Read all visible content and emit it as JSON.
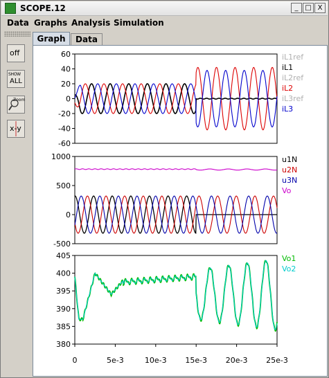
{
  "window": {
    "title": "SCOPE.12",
    "controls": {
      "minimize": "_",
      "maximize": "□",
      "close": "X"
    }
  },
  "menu": [
    "Data",
    "Graphs",
    "Analysis",
    "Simulation"
  ],
  "toolbar": {
    "off": "off",
    "show_all_top": "SHOW",
    "show_all_bottom": "ALL",
    "zoom": "Zoom",
    "xy": "x-y"
  },
  "tabs": [
    "Graph",
    "Data"
  ],
  "colors": {
    "iL1ref": "#b0b0b0",
    "iL1": "#000000",
    "iL2ref": "#b0b0b0",
    "iL2": "#dd0000",
    "iL3ref": "#b0b0b0",
    "iL3": "#0000cc",
    "u1N": "#000000",
    "u2N": "#cc0000",
    "u3N": "#0000aa",
    "Vo": "#cc00cc",
    "Vo1": "#00bb00",
    "Vo2": "#00cccc"
  },
  "chart_data": [
    {
      "type": "line",
      "x_range": [
        0,
        0.025
      ],
      "ylim": [
        -60,
        60
      ],
      "yticks": [
        "60",
        "40",
        "20",
        "0",
        "-20",
        "-40",
        "-60"
      ],
      "legend": [
        "iL1ref",
        "iL1",
        "iL2ref",
        "iL2",
        "iL3ref",
        "iL3"
      ],
      "series": [
        {
          "name": "iL1",
          "description": "sinusoid, amplitude ~20, 50Hz-like ~2.2e-3 s period, drops to ~0 after 15e-3",
          "amp_before": 20,
          "amp_after": 0
        },
        {
          "name": "iL2",
          "amp_before": 20,
          "amp_after": 42
        },
        {
          "name": "iL3",
          "amp_before": 20,
          "amp_after": 38
        }
      ]
    },
    {
      "type": "line",
      "x_range": [
        0,
        0.025
      ],
      "ylim": [
        -500,
        1000
      ],
      "yticks": [
        "1000",
        "500",
        "0",
        "-500"
      ],
      "legend": [
        "u1N",
        "u2N",
        "u3N",
        "Vo"
      ],
      "series": [
        {
          "name": "u1N",
          "amp_before": 320,
          "amp_after": 0
        },
        {
          "name": "u2N",
          "amp_before": 320,
          "amp_after": 320
        },
        {
          "name": "u3N",
          "amp_before": 320,
          "amp_after": 320
        },
        {
          "name": "Vo",
          "level": 785
        }
      ]
    },
    {
      "type": "line",
      "x_range": [
        0,
        0.025
      ],
      "ylim": [
        380,
        405
      ],
      "yticks": [
        "405",
        "400",
        "395",
        "390",
        "385",
        "380"
      ],
      "xticks": [
        "0",
        "5e-3",
        "10e-3",
        "15e-3",
        "20e-3",
        "25e-3"
      ],
      "legend": [
        "Vo1",
        "Vo2"
      ],
      "series": [
        {
          "name": "Vo1",
          "range_before": [
            386,
            400
          ]
        },
        {
          "name": "Vo2",
          "range_after": [
            385,
            402
          ]
        }
      ]
    }
  ]
}
